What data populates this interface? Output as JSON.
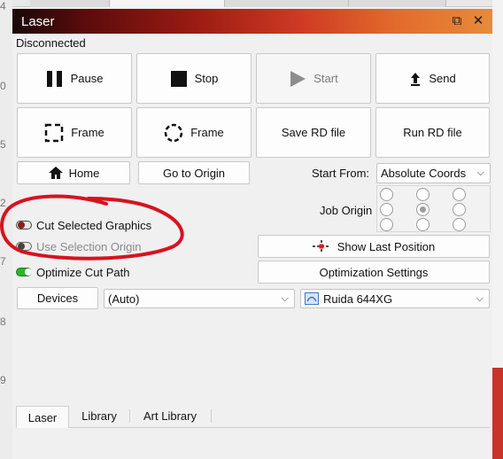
{
  "window": {
    "title": "Laser",
    "float_glyph": "⧉",
    "close_glyph": "✕"
  },
  "status": "Disconnected",
  "buttons": {
    "pause": "Pause",
    "stop": "Stop",
    "start": "Start",
    "send": "Send",
    "frame_rect": "Frame",
    "frame_circle": "Frame",
    "save_rd": "Save RD file",
    "run_rd": "Run RD file",
    "home": "Home",
    "go_to_origin": "Go to Origin",
    "show_last_position": "Show Last Position",
    "optimization_settings": "Optimization Settings",
    "devices": "Devices"
  },
  "start_from": {
    "label": "Start From:",
    "value": "Absolute Coords",
    "arrow": "⌵"
  },
  "job_origin": {
    "label": "Job Origin",
    "selected_index": 4
  },
  "toggles": {
    "cut_selected": {
      "label": "Cut Selected Graphics",
      "on": false
    },
    "use_selection_origin": {
      "label": "Use Selection Origin",
      "on": false,
      "disabled": true
    },
    "optimize_cut_path": {
      "label": "Optimize Cut Path",
      "on": true
    }
  },
  "port": {
    "value": "(Auto)",
    "arrow": "⌵"
  },
  "device": {
    "value": "Ruida 644XG",
    "arrow": "⌵"
  },
  "bottom_tabs": [
    {
      "label": "Laser",
      "active": true
    },
    {
      "label": "Library",
      "active": false
    },
    {
      "label": "Art Library",
      "active": false
    }
  ],
  "side_marks": [
    "4",
    "0",
    "5",
    "2",
    "7",
    "8",
    "9"
  ],
  "colors": {
    "annotation": "#d8121f",
    "toggle_on": "#2bb52b",
    "toggle_off_knob": "#8e1c1c",
    "disabled_text": "#8a8a8a"
  }
}
